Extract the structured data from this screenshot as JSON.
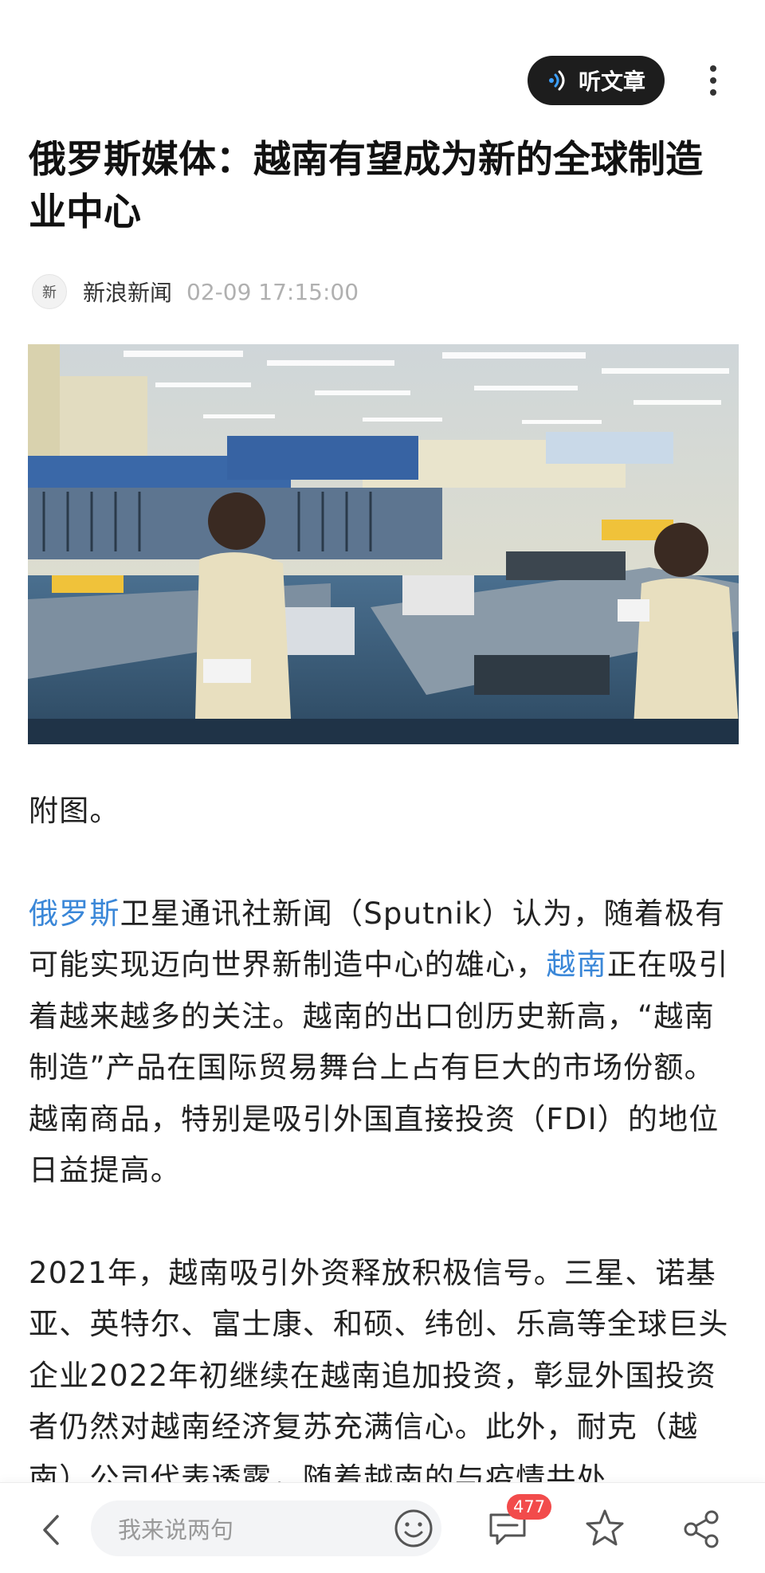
{
  "header": {
    "listen_label": "听文章",
    "listen_icon": "sound-wave-icon",
    "more_icon": "more-vertical-icon"
  },
  "article": {
    "title": "俄罗斯媒体：越南有望成为新的全球制造业中心",
    "source_avatar_text": "新",
    "source_name": "新浪新闻",
    "time": "02-09 17:15:00",
    "image_caption": "附图。",
    "p1": {
      "link1": "俄罗斯",
      "text1": "卫星通讯社新闻（Sputnik）认为，随着极有可能实现迈向世界新制造中心的雄心，",
      "link2": "越南",
      "text2": "正在吸引着越来越多的关注。越南的出口创历史新高，“越南制造”产品在国际贸易舞台上占有巨大的市场份额。 越南商品，特别是吸引外国直接投资（FDI）的地位日益提高。"
    },
    "p2": "2021年，越南吸引外资释放积极信号。三星、诺基亚、英特尔、富士康、和硕、纬创、乐高等全球巨头企业2022年初继续在越南追加投资，彰显外国投资者仍然对越南经济复苏充满信心。此外，耐克（越南）公司代表透露，随着越南的与疫情共处"
  },
  "bottom_bar": {
    "comment_placeholder": "我来说两句",
    "comment_count": "477",
    "icons": [
      "back-icon",
      "emoji-icon",
      "comment-icon",
      "star-icon",
      "share-icon"
    ]
  },
  "colors": {
    "link": "#3a87d8",
    "badge": "#f24b4b",
    "listen_button_bg": "#1d1d1d"
  }
}
